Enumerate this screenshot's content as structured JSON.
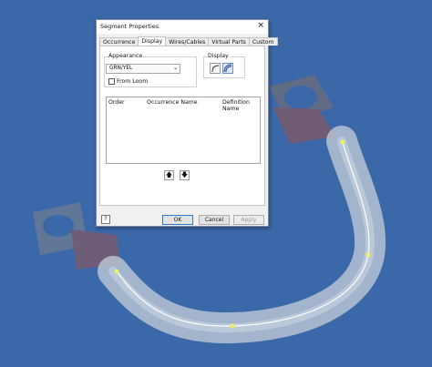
{
  "dialog": {
    "title": "Segment Properties",
    "close_glyph": "×",
    "tabs": [
      {
        "label": "Occurrence"
      },
      {
        "label": "Display"
      },
      {
        "label": "Wires/Cables"
      },
      {
        "label": "Virtual Parts"
      },
      {
        "label": "Custom"
      }
    ],
    "active_tab": "Display",
    "appearance": {
      "label": "Appearance",
      "value": "GRN/YEL"
    },
    "from_loom": {
      "label": "From Loom",
      "checked": false
    },
    "display_group": {
      "label": "Display",
      "icons": [
        "centerline-display-icon",
        "rendered-display-icon"
      ]
    },
    "table": {
      "columns": [
        "Order",
        "Occurrence Name",
        "Definition Name"
      ],
      "rows": []
    },
    "move_up_glyph": "🡅",
    "move_down_glyph": "🡇",
    "buttons": {
      "help": "?",
      "ok": "OK",
      "cancel": "Cancel",
      "apply": "Apply"
    }
  },
  "colors": {
    "background": "#3a68a8",
    "tube": "#c2cad6",
    "path_line": "#ffffff",
    "work_point": "#f0f060"
  }
}
